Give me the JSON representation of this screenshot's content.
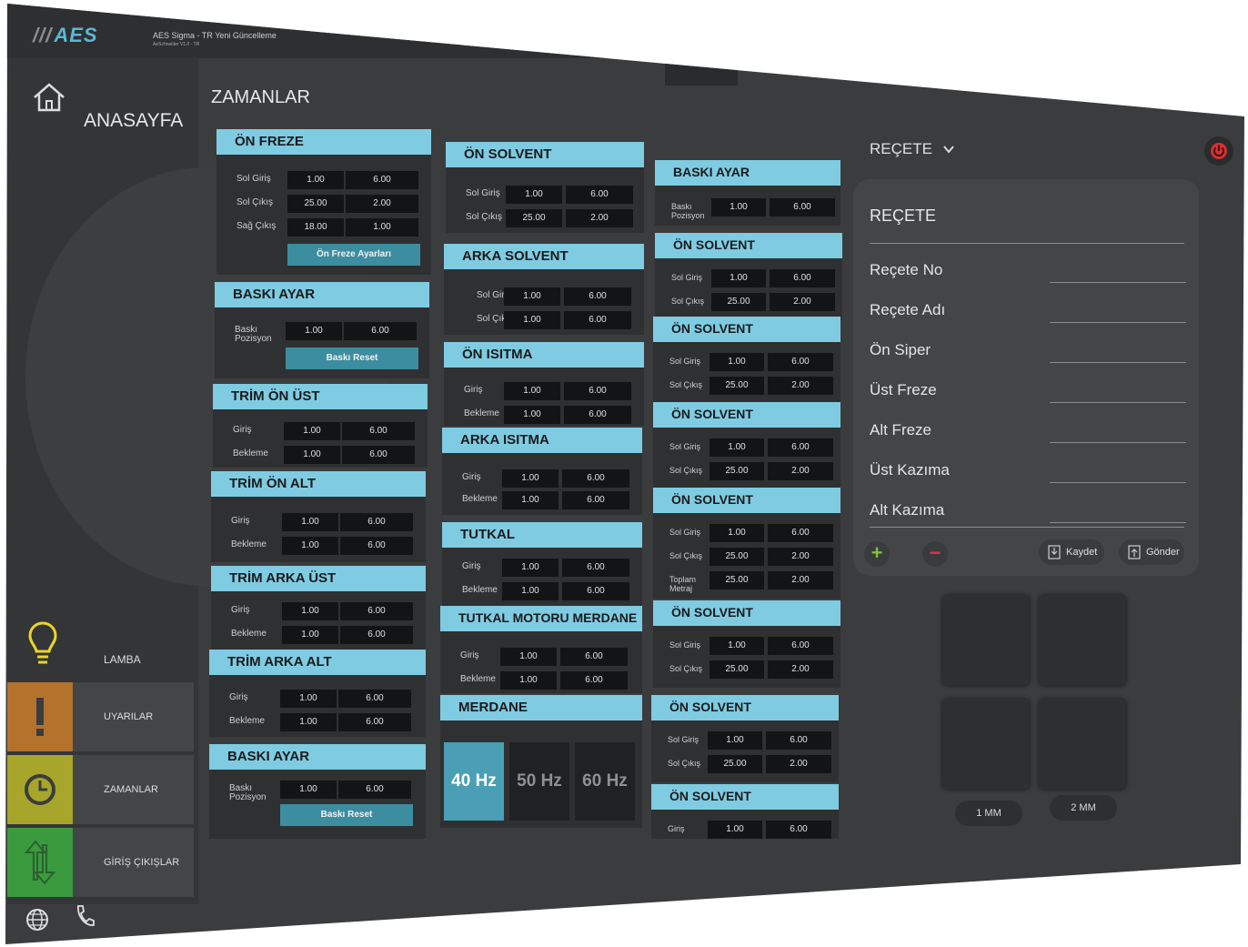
{
  "app": {
    "logo": "AES",
    "title": "AES Sigma - TR Yeni Güncelleme",
    "subtitle": "AeSchneider V1.0 - TR"
  },
  "sidebar": {
    "home_label": "ANASAYFA",
    "lamp_label": "LAMBA",
    "nav": [
      {
        "label": "UYARILAR",
        "icon": "exclamation-icon",
        "color": "#b4722c"
      },
      {
        "label": "ZAMANLAR",
        "icon": "clock-icon",
        "color": "#a7a52a"
      },
      {
        "label": "GİRİŞ ÇIKIŞLAR",
        "icon": "up-down-arrows-icon",
        "color": "#3a9a3e"
      }
    ],
    "bottom_icons": [
      "globe-icon",
      "phone-icon"
    ]
  },
  "page_title": "ZAMANLAR",
  "col1": {
    "on_freze": {
      "title": "ÖN FREZE",
      "rows": [
        {
          "label": "Sol Giriş",
          "v1": "1.00",
          "v2": "6.00"
        },
        {
          "label": "Sol Çıkış",
          "v1": "25.00",
          "v2": "2.00"
        },
        {
          "label": "Sağ Çıkış",
          "v1": "18.00",
          "v2": "1.00"
        }
      ],
      "button": "Ön Freze Ayarları"
    },
    "baski_ayar": {
      "title": "BASKI AYAR",
      "rows": [
        {
          "label": "Baskı Pozisyon",
          "v1": "1.00",
          "v2": "6.00"
        }
      ],
      "button": "Baskı Reset"
    },
    "trim_on_ust": {
      "title": "TRİM ÖN ÜST",
      "rows": [
        {
          "label": "Giriş",
          "v1": "1.00",
          "v2": "6.00"
        },
        {
          "label": "Bekleme",
          "v1": "1.00",
          "v2": "6.00"
        }
      ]
    },
    "trim_on_alt": {
      "title": "TRİM ÖN ALT",
      "rows": [
        {
          "label": "Giriş",
          "v1": "1.00",
          "v2": "6.00"
        },
        {
          "label": "Bekleme",
          "v1": "1.00",
          "v2": "6.00"
        }
      ]
    },
    "trim_arka_ust": {
      "title": "TRİM ARKA ÜST",
      "rows": [
        {
          "label": "Giriş",
          "v1": "1.00",
          "v2": "6.00"
        },
        {
          "label": "Bekleme",
          "v1": "1.00",
          "v2": "6.00"
        }
      ]
    },
    "trim_arka_alt": {
      "title": "TRİM ARKA ALT",
      "rows": [
        {
          "label": "Giriş",
          "v1": "1.00",
          "v2": "6.00"
        },
        {
          "label": "Bekleme",
          "v1": "1.00",
          "v2": "6.00"
        }
      ]
    },
    "baski_ayar2": {
      "title": "BASKI AYAR",
      "rows": [
        {
          "label": "Baskı Pozisyon",
          "v1": "1.00",
          "v2": "6.00"
        }
      ],
      "button": "Baskı Reset"
    }
  },
  "col2": {
    "on_solvent": {
      "title": "ÖN SOLVENT",
      "rows": [
        {
          "label": "Sol Giriş",
          "v1": "1.00",
          "v2": "6.00"
        },
        {
          "label": "Sol Çıkış",
          "v1": "25.00",
          "v2": "2.00"
        }
      ]
    },
    "arka_solvent": {
      "title": "ARKA SOLVENT",
      "rows": [
        {
          "label": "Sol Giriş",
          "v1": "1.00",
          "v2": "6.00"
        },
        {
          "label": "Sol Çıkış",
          "v1": "1.00",
          "v2": "6.00"
        }
      ]
    },
    "on_isitma": {
      "title": "ÖN ISITMA",
      "rows": [
        {
          "label": "Giriş",
          "v1": "1.00",
          "v2": "6.00"
        },
        {
          "label": "Bekleme",
          "v1": "1.00",
          "v2": "6.00"
        }
      ]
    },
    "arka_isitma": {
      "title": "ARKA ISITMA",
      "rows": [
        {
          "label": "Giriş",
          "v1": "1.00",
          "v2": "6.00"
        },
        {
          "label": "Bekleme",
          "v1": "1.00",
          "v2": "6.00"
        }
      ]
    },
    "tutkal": {
      "title": "TUTKAL",
      "rows": [
        {
          "label": "Giriş",
          "v1": "1.00",
          "v2": "6.00"
        },
        {
          "label": "Bekleme",
          "v1": "1.00",
          "v2": "6.00"
        }
      ]
    },
    "tutkal_motoru": {
      "title": "TUTKAL MOTORU MERDANE",
      "rows": [
        {
          "label": "Giriş",
          "v1": "1.00",
          "v2": "6.00"
        },
        {
          "label": "Bekleme",
          "v1": "1.00",
          "v2": "6.00"
        }
      ]
    },
    "merdane": {
      "title": "MERDANE",
      "options": [
        "40 Hz",
        "50 Hz",
        "60 Hz"
      ],
      "selected": "40 Hz"
    }
  },
  "col3": {
    "baski_ayar": {
      "title": "BASKI AYAR",
      "rows": [
        {
          "label": "Baskı Pozisyon",
          "v1": "1.00",
          "v2": "6.00"
        }
      ]
    },
    "panels": [
      {
        "title": "ÖN SOLVENT",
        "rows": [
          {
            "label": "Sol Giriş",
            "v1": "1.00",
            "v2": "6.00"
          },
          {
            "label": "Sol Çıkış",
            "v1": "25.00",
            "v2": "2.00"
          }
        ]
      },
      {
        "title": "ÖN SOLVENT",
        "rows": [
          {
            "label": "Sol Giriş",
            "v1": "1.00",
            "v2": "6.00"
          },
          {
            "label": "Sol Çıkış",
            "v1": "25.00",
            "v2": "2.00"
          }
        ]
      },
      {
        "title": "ÖN SOLVENT",
        "rows": [
          {
            "label": "Sol Giriş",
            "v1": "1.00",
            "v2": "6.00"
          },
          {
            "label": "Sol Çıkış",
            "v1": "25.00",
            "v2": "2.00"
          }
        ]
      },
      {
        "title": "ÖN SOLVENT",
        "rows": [
          {
            "label": "Sol Giriş",
            "v1": "1.00",
            "v2": "6.00"
          },
          {
            "label": "Sol Çıkış",
            "v1": "25.00",
            "v2": "2.00"
          },
          {
            "label": "Toplam Metraj",
            "v1": "25.00",
            "v2": "2.00"
          }
        ]
      },
      {
        "title": "ÖN SOLVENT",
        "rows": [
          {
            "label": "Sol Giriş",
            "v1": "1.00",
            "v2": "6.00"
          },
          {
            "label": "Sol Çıkış",
            "v1": "25.00",
            "v2": "2.00"
          }
        ]
      },
      {
        "title": "ÖN SOLVENT",
        "rows": [
          {
            "label": "Sol Giriş",
            "v1": "1.00",
            "v2": "6.00"
          },
          {
            "label": "Sol Çıkış",
            "v1": "25.00",
            "v2": "2.00"
          }
        ]
      },
      {
        "title": "ÖN SOLVENT",
        "rows": [
          {
            "label": "Giriş",
            "v1": "1.00",
            "v2": "6.00"
          }
        ]
      }
    ]
  },
  "recipe": {
    "dropdown_label": "REÇETE",
    "card_title": "REÇETE",
    "fields": [
      "Reçete No",
      "Reçete Adı",
      "Ön Siper",
      "Üst Freze",
      "Alt Freze",
      "Üst Kazıma",
      "Alt Kazıma"
    ],
    "add_symbol": "+",
    "remove_symbol": "−",
    "save_label": "Kaydet",
    "send_label": "Gönder",
    "add_color": "#7bc143",
    "remove_color": "#d2394f"
  },
  "mm_buttons": [
    "1 MM",
    "2 MM"
  ],
  "colors": {
    "header": "#7fcbe2",
    "accent_button": "#3d8da0",
    "active_hz": "#4a9fb5",
    "power": "#d6302e"
  }
}
